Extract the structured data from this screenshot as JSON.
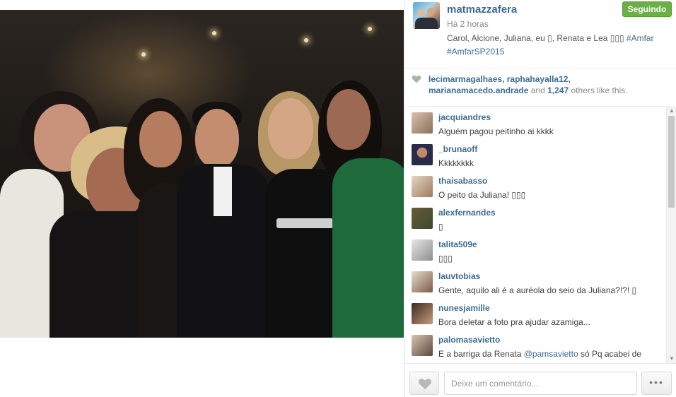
{
  "post": {
    "username": "matmazzafera",
    "follow_label": "Seguindo",
    "time": "Há 2 horas",
    "caption_text": "Carol, Alcione, Juliana, eu ▯, Renata e Lea ▯▯▯ ",
    "caption_tag1": "#Amfar",
    "caption_tag2": "#AmfarSP2015"
  },
  "likes": {
    "users": "lecimarmagalhaes, raphahayalla12, marianamacedo.andrade",
    "and_text": " and ",
    "count": "1,247",
    "suffix": " others like this."
  },
  "comments": [
    {
      "user": "jacquiandres",
      "text": "Alguém pagou peitinho ai kkkk"
    },
    {
      "user": "_brunaoff",
      "text": "Kkkkkkkk"
    },
    {
      "user": "thaisabasso",
      "text": "O peito da Juliana! ▯▯▯"
    },
    {
      "user": "alexfernandes",
      "text": "▯"
    },
    {
      "user": "talita509e",
      "text": "▯▯▯"
    },
    {
      "user": "lauvtobias",
      "text": "Gente, aquilo ali é a auréola do seio da Juliana?!?! ▯"
    },
    {
      "user": "nunesjamille",
      "text": "Bora deletar a foto pra ajudar azamiga..."
    },
    {
      "user": "palomasavietto",
      "text_before": "E a barriga da Renata ",
      "mention": "@pamsavietto",
      "text_after": " só Pq acabei de comer um lanche ▯"
    }
  ],
  "footer": {
    "comment_placeholder": "Deixe um comentário...",
    "more_label": "•••"
  },
  "colors": {
    "link": "#3b6c93",
    "follow_green": "#6bb045"
  },
  "icons": {
    "like": "heart-icon",
    "more": "more-options-icon",
    "scroll_up": "scroll-up-arrow-icon",
    "scroll_down": "scroll-down-arrow-icon"
  }
}
